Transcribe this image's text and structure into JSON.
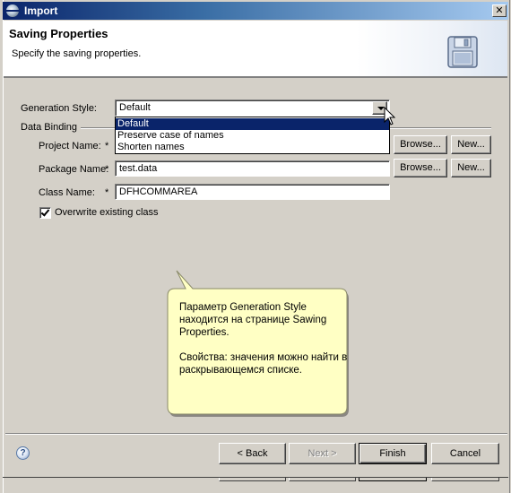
{
  "window": {
    "title": "Import",
    "close_label": "✕"
  },
  "header": {
    "title": "Saving Properties",
    "subtitle": "Specify the saving properties.",
    "banner_icon": "floppy-disk-icon"
  },
  "form": {
    "generation_style": {
      "label": "Generation Style:",
      "value": "Default",
      "options": [
        "Default",
        "Preserve case of names",
        "Shorten names"
      ],
      "selected_index": 0
    },
    "data_binding_label": "Data Binding",
    "project_name": {
      "label": "Project Name:",
      "required": "*",
      "value": "",
      "browse": "Browse...",
      "new": "New..."
    },
    "package_name": {
      "label": "Package Name:",
      "required": "*",
      "value": "test.data",
      "browse": "Browse...",
      "new": "New..."
    },
    "class_name": {
      "label": "Class Name:",
      "required": "*",
      "value": "DFHCOMMAREA"
    },
    "overwrite": {
      "label": "Overwrite existing class",
      "checked": true
    }
  },
  "callout": {
    "line1": "Параметр Generation Style находится на странице Sawing Properties.",
    "line2": "Свойства:  значения можно найти в раскрывающемся списке."
  },
  "footer": {
    "help_label": "?",
    "back": "< Back",
    "next": "Next >",
    "finish": "Finish",
    "cancel": "Cancel"
  }
}
